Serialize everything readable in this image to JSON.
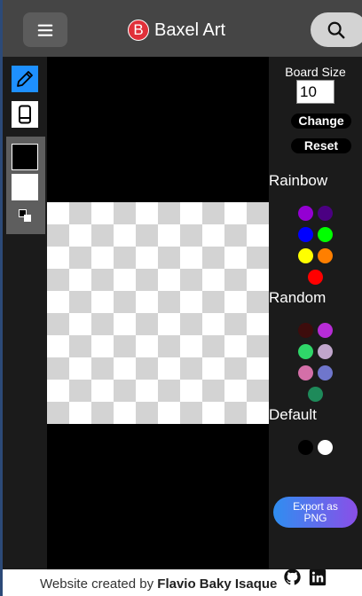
{
  "header": {
    "menu_icon": "hamburger-icon",
    "logo_letter": "B",
    "title": "Baxel Art",
    "search_icon": "search-icon"
  },
  "tools": {
    "pencil_icon": "pencil-icon",
    "eraser_icon": "eraser-icon",
    "primary_color": "#000000",
    "secondary_color": "#ffffff",
    "swap_icon": "swap-colors-icon"
  },
  "board": {
    "size": 10,
    "checker_light": "#ffffff",
    "checker_dark": "#d3d3d3"
  },
  "controls": {
    "board_size_label": "Board Size",
    "board_size_value": "10",
    "change_label": "Change",
    "reset_label": "Reset"
  },
  "palettes": {
    "rainbow": {
      "title": "Rainbow",
      "colors": [
        "#9400d3",
        "#4b0082",
        "#0000ff",
        "#00ff00",
        "#ffff00",
        "#ff7f00",
        "#ff0000"
      ]
    },
    "random": {
      "title": "Random",
      "colors": [
        "#3d0c0c",
        "#b72cd6",
        "#2fd669",
        "#c1a6cc",
        "#d46fa8",
        "#6f76cc",
        "#1e8a5a"
      ]
    },
    "default": {
      "title": "Default",
      "colors": [
        "#000000",
        "#ffffff"
      ]
    }
  },
  "export": {
    "label": "Export as PNG"
  },
  "footer": {
    "prefix": "Website created by ",
    "author": "Flavio Baky Isaque",
    "github_icon": "github-icon",
    "linkedin_icon": "linkedin-icon"
  }
}
